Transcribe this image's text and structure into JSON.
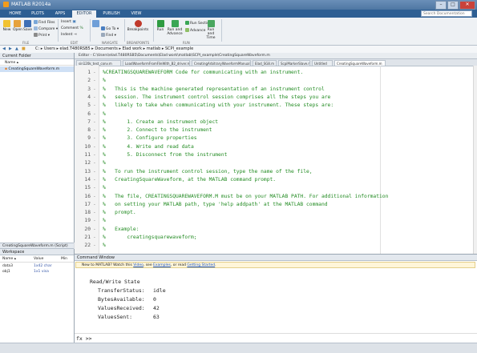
{
  "window": {
    "title": "MATLAB R2014a"
  },
  "tabs": [
    "HOME",
    "PLOTS",
    "APPS",
    "EDITOR",
    "PUBLISH",
    "VIEW"
  ],
  "search": {
    "placeholder": "Search Documentation"
  },
  "ribbon": {
    "file": {
      "new": "New",
      "open": "Open",
      "save": "Save",
      "find_files": "Find Files",
      "compare": "Compare",
      "print": "Print",
      "section": "FILE"
    },
    "edit": {
      "insert": "Insert",
      "comment": "Comment",
      "indent": "Indent",
      "section": "EDIT"
    },
    "navigate": {
      "goto": "Go To",
      "find": "Find",
      "section": "NAVIGATE"
    },
    "breakpoints": {
      "label": "Breakpoints",
      "section": "BREAKPOINTS"
    },
    "run": {
      "run": "Run",
      "run_advance": "Run and Advance",
      "run_section": "Run Section",
      "advance": "Advance",
      "run_time": "Run and Time",
      "section": "RUN"
    }
  },
  "address": {
    "path": "C: ▸ Users ▸ elad.T480RSB5 ▸ Documents ▸ Elad work ▸ matlab ▸ SCPI_example"
  },
  "current_folder": {
    "title": "Current Folder",
    "col_name": "Name ▴",
    "items": [
      "CreatingSquareWaveform.m"
    ],
    "footer": "CreatingSquareWaveform.m (Script)"
  },
  "workspace": {
    "title": "Workspace",
    "col_name": "Name ▴",
    "col_value": "Value",
    "col_min": "Min",
    "rows": [
      {
        "name": "data3",
        "value": "1x42 char"
      },
      {
        "name": "obj1",
        "value": "1x1 visa"
      }
    ]
  },
  "editor": {
    "title": "Editor - C:\\Users\\elad.T480RSB5\\Documents\\Elad work\\matlab\\SCPI_example\\CreatingSquareWaveform.m",
    "tabs": [
      "sin120k_test_conv.m",
      "LoadWaveformFromFileWith_B2_driver.m",
      "CreatingArbitraryWaveformManually.m",
      "Elad_SG8.m",
      "ScpiMarkerSlave.m",
      "Untitled",
      "CreatingSquareWaveform.m"
    ],
    "active_tab": 6,
    "lines": [
      "%CREATINGSQUAREWAVEFORM Code for communicating with an instrument.",
      "%",
      "%   This is the machine generated representation of an instrument control",
      "%   session. The instrument control session comprises all the steps you are",
      "%   likely to take when communicating with your instrument. These steps are:",
      "%",
      "%       1. Create an instrument object",
      "%       2. Connect to the instrument",
      "%       3. Configure properties",
      "%       4. Write and read data",
      "%       5. Disconnect from the instrument",
      "%",
      "%   To run the instrument control session, type the name of the file,",
      "%   CreatingSquareWaveform, at the MATLAB command prompt.",
      "%",
      "%   The file, CREATINGSQUAREWAVEFORM.M must be on your MATLAB PATH. For additional information",
      "%   on setting your MATLAB path, type 'help addpath' at the MATLAB command",
      "%   prompt.",
      "%",
      "%   Example:",
      "%       creatingsquarewaveform;",
      "%"
    ]
  },
  "command_window": {
    "title": "Command Window",
    "notice_pre": "New to MATLAB? Watch this ",
    "notice_video": "Video",
    "notice_mid": ", see ",
    "notice_examples": "Examples",
    "notice_mid2": ", or read ",
    "notice_started": "Getting Started",
    "notice_end": ".",
    "output_title": "Read/Write State",
    "fields": [
      {
        "label": "TransferStatus:",
        "value": "idle"
      },
      {
        "label": "BytesAvailable:",
        "value": "0"
      },
      {
        "label": "ValuesReceived:",
        "value": "42"
      },
      {
        "label": "ValuesSent:",
        "value": "63"
      }
    ],
    "prompt": "fx >>"
  },
  "colors": {
    "tabbar": "#2e5f93",
    "comment": "#228b22",
    "link": "#1a55c7"
  }
}
